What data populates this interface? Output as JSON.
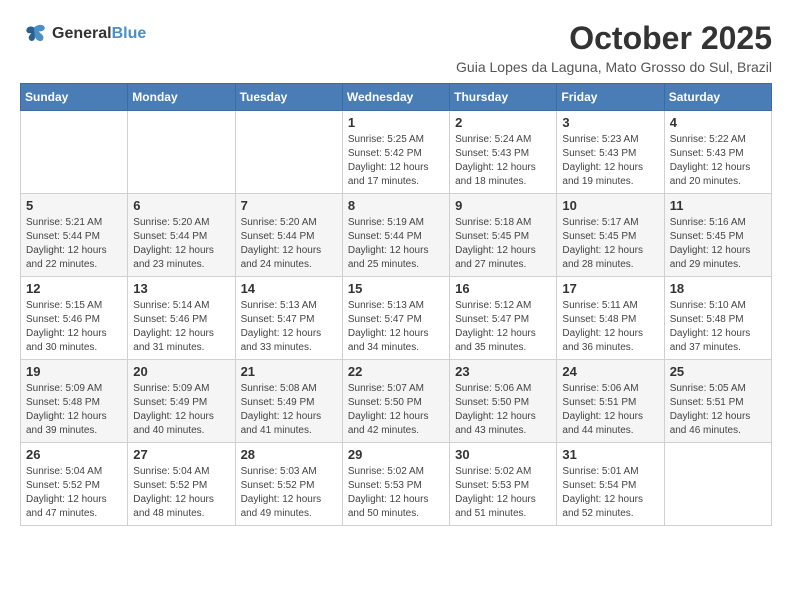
{
  "header": {
    "logo_line1": "General",
    "logo_line2": "Blue",
    "title": "October 2025",
    "subtitle": "Guia Lopes da Laguna, Mato Grosso do Sul, Brazil"
  },
  "days_of_week": [
    "Sunday",
    "Monday",
    "Tuesday",
    "Wednesday",
    "Thursday",
    "Friday",
    "Saturday"
  ],
  "weeks": [
    [
      {
        "day": "",
        "info": ""
      },
      {
        "day": "",
        "info": ""
      },
      {
        "day": "",
        "info": ""
      },
      {
        "day": "1",
        "info": "Sunrise: 5:25 AM\nSunset: 5:42 PM\nDaylight: 12 hours\nand 17 minutes."
      },
      {
        "day": "2",
        "info": "Sunrise: 5:24 AM\nSunset: 5:43 PM\nDaylight: 12 hours\nand 18 minutes."
      },
      {
        "day": "3",
        "info": "Sunrise: 5:23 AM\nSunset: 5:43 PM\nDaylight: 12 hours\nand 19 minutes."
      },
      {
        "day": "4",
        "info": "Sunrise: 5:22 AM\nSunset: 5:43 PM\nDaylight: 12 hours\nand 20 minutes."
      }
    ],
    [
      {
        "day": "5",
        "info": "Sunrise: 5:21 AM\nSunset: 5:44 PM\nDaylight: 12 hours\nand 22 minutes."
      },
      {
        "day": "6",
        "info": "Sunrise: 5:20 AM\nSunset: 5:44 PM\nDaylight: 12 hours\nand 23 minutes."
      },
      {
        "day": "7",
        "info": "Sunrise: 5:20 AM\nSunset: 5:44 PM\nDaylight: 12 hours\nand 24 minutes."
      },
      {
        "day": "8",
        "info": "Sunrise: 5:19 AM\nSunset: 5:44 PM\nDaylight: 12 hours\nand 25 minutes."
      },
      {
        "day": "9",
        "info": "Sunrise: 5:18 AM\nSunset: 5:45 PM\nDaylight: 12 hours\nand 27 minutes."
      },
      {
        "day": "10",
        "info": "Sunrise: 5:17 AM\nSunset: 5:45 PM\nDaylight: 12 hours\nand 28 minutes."
      },
      {
        "day": "11",
        "info": "Sunrise: 5:16 AM\nSunset: 5:45 PM\nDaylight: 12 hours\nand 29 minutes."
      }
    ],
    [
      {
        "day": "12",
        "info": "Sunrise: 5:15 AM\nSunset: 5:46 PM\nDaylight: 12 hours\nand 30 minutes."
      },
      {
        "day": "13",
        "info": "Sunrise: 5:14 AM\nSunset: 5:46 PM\nDaylight: 12 hours\nand 31 minutes."
      },
      {
        "day": "14",
        "info": "Sunrise: 5:13 AM\nSunset: 5:47 PM\nDaylight: 12 hours\nand 33 minutes."
      },
      {
        "day": "15",
        "info": "Sunrise: 5:13 AM\nSunset: 5:47 PM\nDaylight: 12 hours\nand 34 minutes."
      },
      {
        "day": "16",
        "info": "Sunrise: 5:12 AM\nSunset: 5:47 PM\nDaylight: 12 hours\nand 35 minutes."
      },
      {
        "day": "17",
        "info": "Sunrise: 5:11 AM\nSunset: 5:48 PM\nDaylight: 12 hours\nand 36 minutes."
      },
      {
        "day": "18",
        "info": "Sunrise: 5:10 AM\nSunset: 5:48 PM\nDaylight: 12 hours\nand 37 minutes."
      }
    ],
    [
      {
        "day": "19",
        "info": "Sunrise: 5:09 AM\nSunset: 5:48 PM\nDaylight: 12 hours\nand 39 minutes."
      },
      {
        "day": "20",
        "info": "Sunrise: 5:09 AM\nSunset: 5:49 PM\nDaylight: 12 hours\nand 40 minutes."
      },
      {
        "day": "21",
        "info": "Sunrise: 5:08 AM\nSunset: 5:49 PM\nDaylight: 12 hours\nand 41 minutes."
      },
      {
        "day": "22",
        "info": "Sunrise: 5:07 AM\nSunset: 5:50 PM\nDaylight: 12 hours\nand 42 minutes."
      },
      {
        "day": "23",
        "info": "Sunrise: 5:06 AM\nSunset: 5:50 PM\nDaylight: 12 hours\nand 43 minutes."
      },
      {
        "day": "24",
        "info": "Sunrise: 5:06 AM\nSunset: 5:51 PM\nDaylight: 12 hours\nand 44 minutes."
      },
      {
        "day": "25",
        "info": "Sunrise: 5:05 AM\nSunset: 5:51 PM\nDaylight: 12 hours\nand 46 minutes."
      }
    ],
    [
      {
        "day": "26",
        "info": "Sunrise: 5:04 AM\nSunset: 5:52 PM\nDaylight: 12 hours\nand 47 minutes."
      },
      {
        "day": "27",
        "info": "Sunrise: 5:04 AM\nSunset: 5:52 PM\nDaylight: 12 hours\nand 48 minutes."
      },
      {
        "day": "28",
        "info": "Sunrise: 5:03 AM\nSunset: 5:52 PM\nDaylight: 12 hours\nand 49 minutes."
      },
      {
        "day": "29",
        "info": "Sunrise: 5:02 AM\nSunset: 5:53 PM\nDaylight: 12 hours\nand 50 minutes."
      },
      {
        "day": "30",
        "info": "Sunrise: 5:02 AM\nSunset: 5:53 PM\nDaylight: 12 hours\nand 51 minutes."
      },
      {
        "day": "31",
        "info": "Sunrise: 5:01 AM\nSunset: 5:54 PM\nDaylight: 12 hours\nand 52 minutes."
      },
      {
        "day": "",
        "info": ""
      }
    ]
  ]
}
